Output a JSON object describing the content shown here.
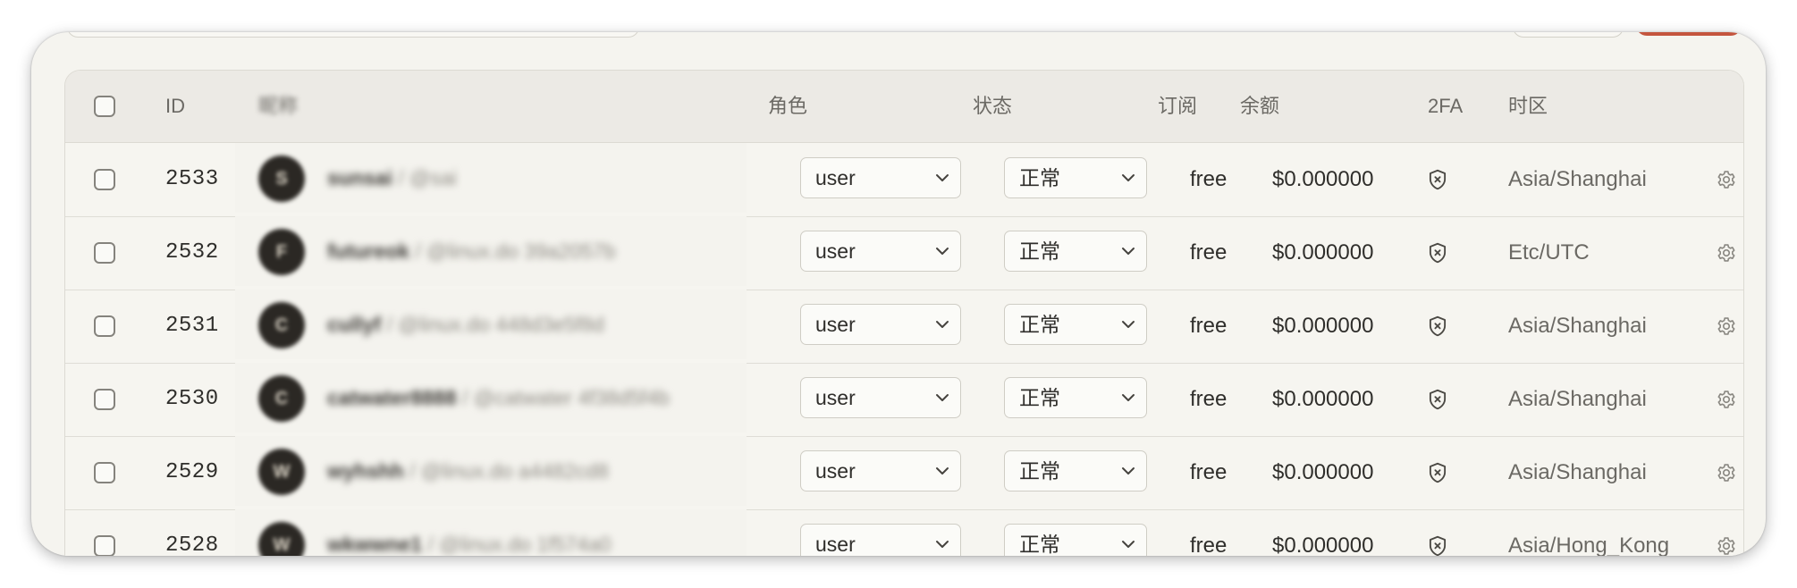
{
  "toolbar": {},
  "table": {
    "columns": {
      "id": "ID",
      "name": "昵称",
      "role": "角色",
      "status": "状态",
      "subscription": "订阅",
      "balance": "余额",
      "twofa": "2FA",
      "timezone": "时区"
    },
    "rows": [
      {
        "id": "2533",
        "avatar_initial": "S",
        "name": "sunsai",
        "sub": "@sai",
        "role": "user",
        "status": "正常",
        "subscription": "free",
        "balance": "$0.000000",
        "timezone": "Asia/Shanghai"
      },
      {
        "id": "2532",
        "avatar_initial": "F",
        "name": "futureok",
        "sub": "@linux.do 39a2057b",
        "role": "user",
        "status": "正常",
        "subscription": "free",
        "balance": "$0.000000",
        "timezone": "Etc/UTC"
      },
      {
        "id": "2531",
        "avatar_initial": "C",
        "name": "cullyf",
        "sub": "@linux.do 448d3e5f8d",
        "role": "user",
        "status": "正常",
        "subscription": "free",
        "balance": "$0.000000",
        "timezone": "Asia/Shanghai"
      },
      {
        "id": "2530",
        "avatar_initial": "C",
        "name": "catwater8888",
        "sub": "@catwater 4f38d5f4b",
        "role": "user",
        "status": "正常",
        "subscription": "free",
        "balance": "$0.000000",
        "timezone": "Asia/Shanghai"
      },
      {
        "id": "2529",
        "avatar_initial": "W",
        "name": "wyhshh",
        "sub": "@linux.do a4482cd8",
        "role": "user",
        "status": "正常",
        "subscription": "free",
        "balance": "$0.000000",
        "timezone": "Asia/Shanghai"
      },
      {
        "id": "2528",
        "avatar_initial": "W",
        "name": "wkwwne1",
        "sub": "@linux.do 1f574a0",
        "role": "user",
        "status": "正常",
        "subscription": "free",
        "balance": "$0.000000",
        "timezone": "Asia/Hong_Kong"
      }
    ]
  },
  "icons": {
    "twofa": "shield-x-icon",
    "settings": "gear-icon",
    "dropdown": "chevron-down-icon"
  },
  "colors": {
    "primary_button": "#c4553e",
    "background": "#f5f4ef",
    "header_background": "#eceae5"
  }
}
